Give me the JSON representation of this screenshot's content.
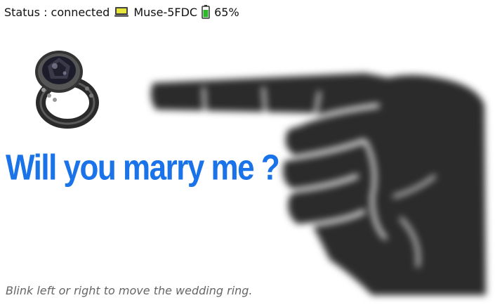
{
  "status": {
    "label": "Status : connected",
    "device_icon": "monitor-icon",
    "device_name": "Muse-5FDC",
    "battery_icon": "battery-icon",
    "battery_percent": "65%",
    "colors": {
      "battery_fill": "#2eb82e",
      "device_screen": "#e6e63a"
    }
  },
  "ring": {
    "icon": "wedding-ring-image"
  },
  "hand": {
    "icon": "pointing-hand-image"
  },
  "headline": {
    "text": "Will you marry me ?",
    "color": "#1a73e8"
  },
  "instruction": {
    "text": "Blink left or right to move the wedding ring."
  }
}
